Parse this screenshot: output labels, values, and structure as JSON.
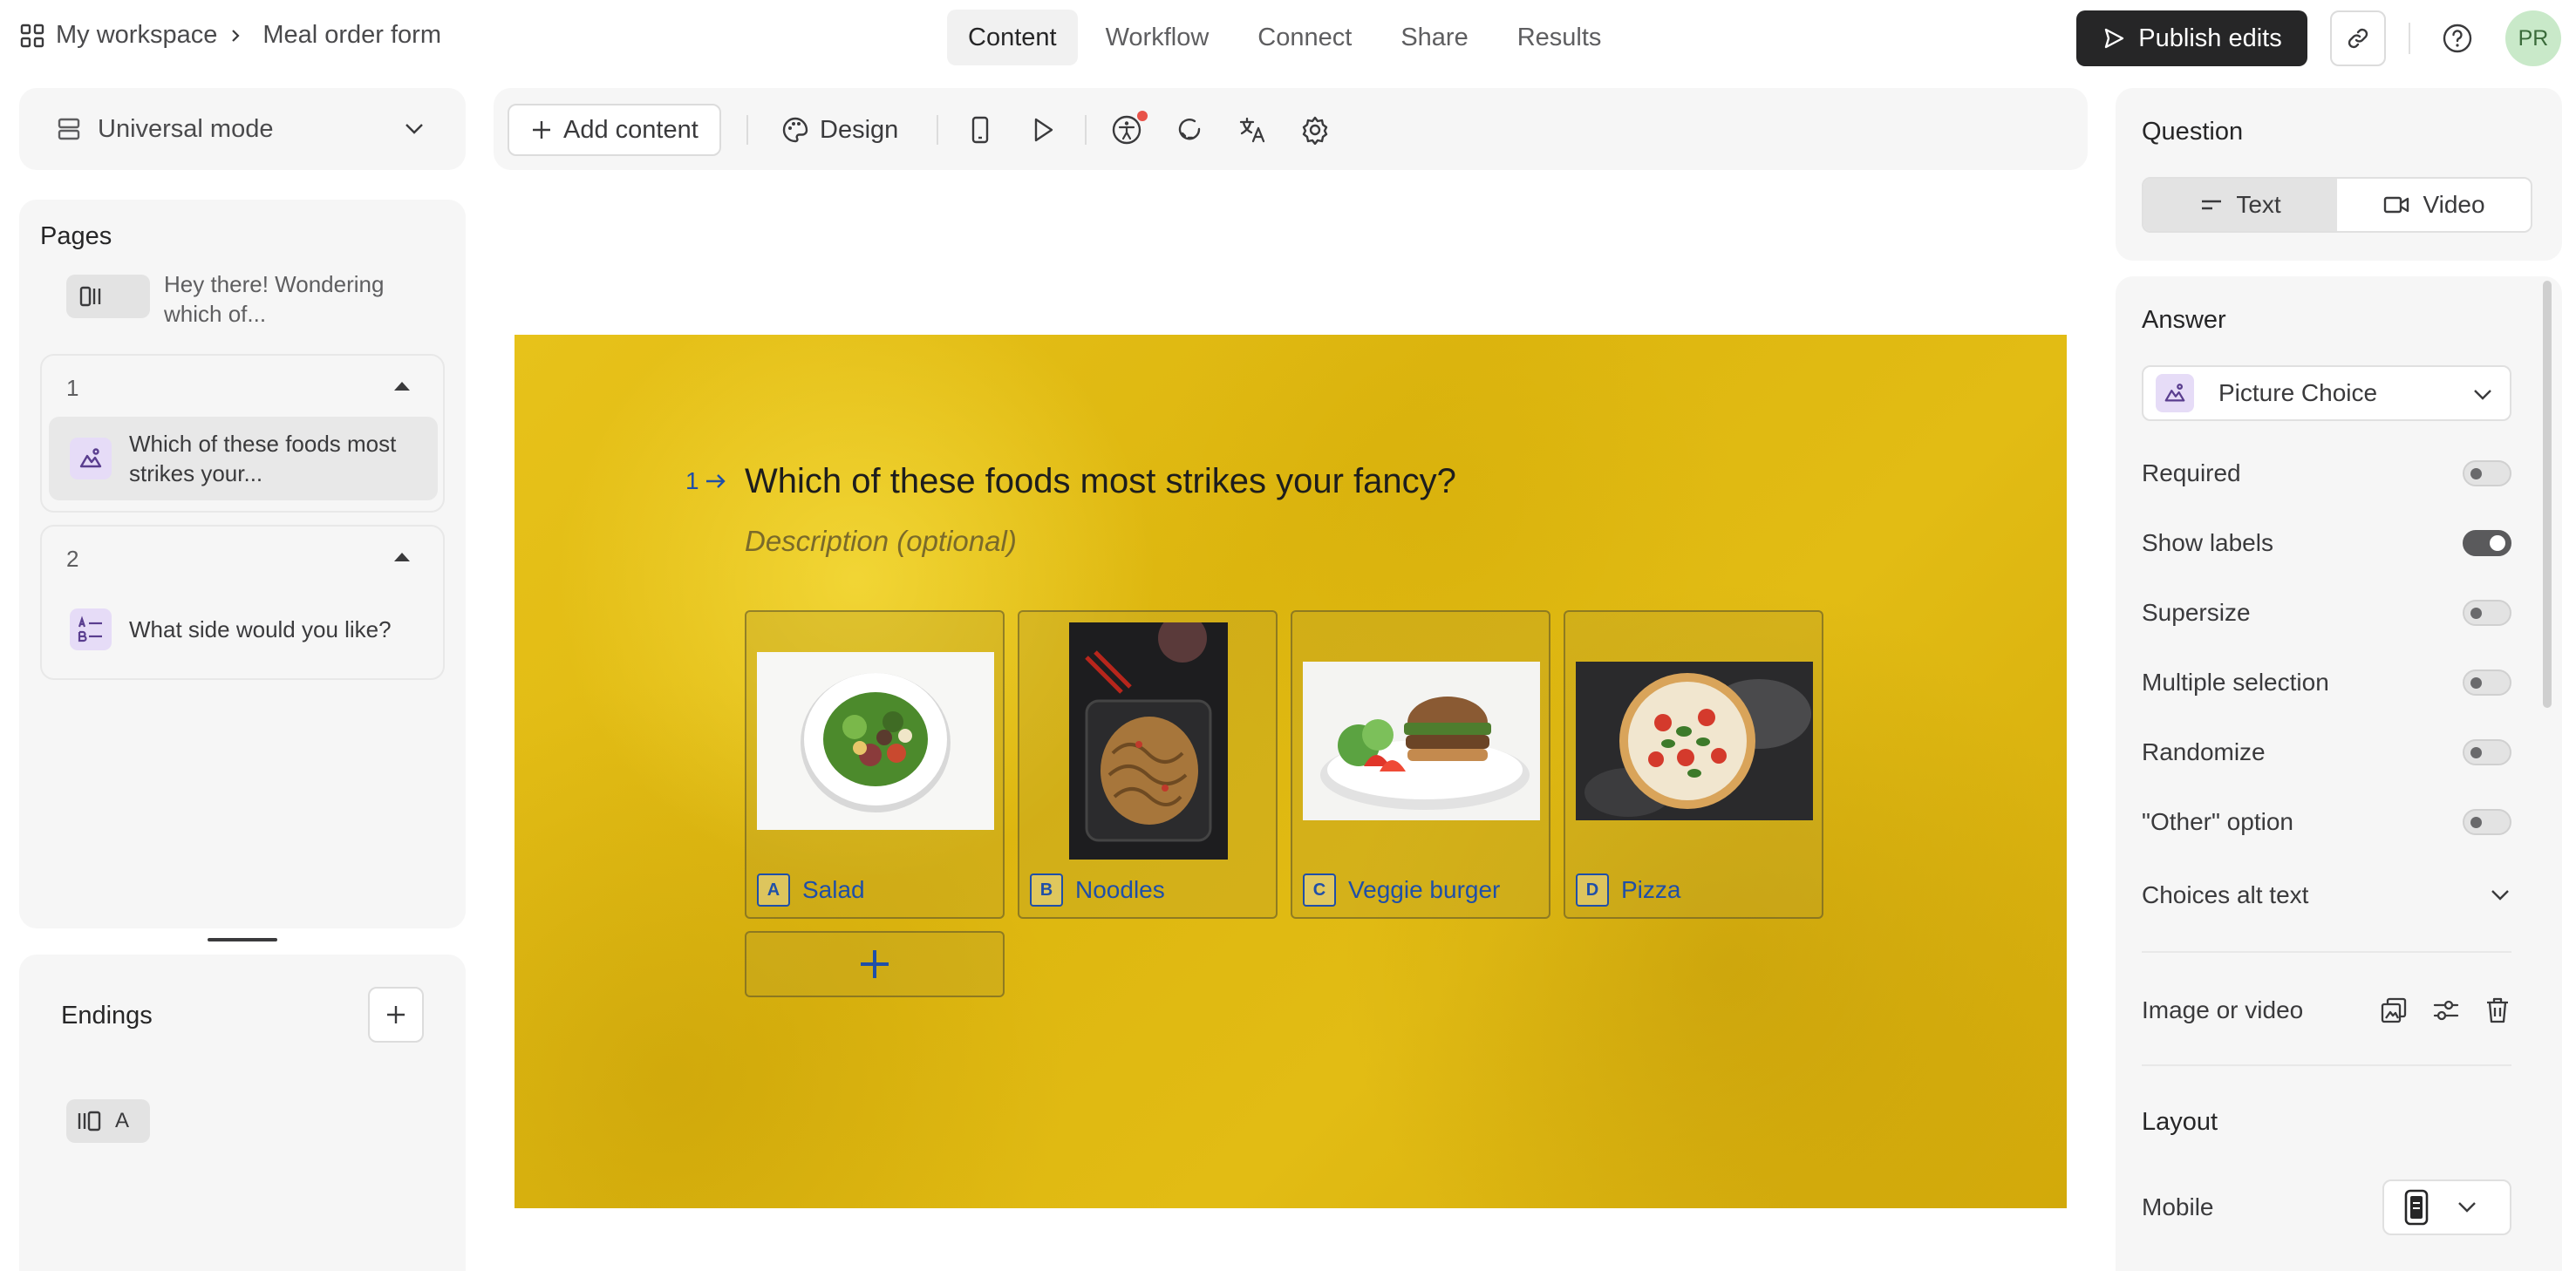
{
  "breadcrumb": {
    "workspace": "My workspace",
    "form": "Meal order form"
  },
  "nav": {
    "tabs": [
      "Content",
      "Workflow",
      "Connect",
      "Share",
      "Results"
    ],
    "active": "Content"
  },
  "header": {
    "publish_label": "Publish edits",
    "avatar_initials": "PR"
  },
  "left": {
    "mode_label": "Universal mode",
    "pages_title": "Pages",
    "welcome_text": "Hey there! Wondering which of...",
    "pages": [
      {
        "number": "1",
        "question": "Which of these foods most strikes your..."
      },
      {
        "number": "2",
        "question": "What side would you like?"
      }
    ],
    "endings_title": "Endings",
    "ending_label": "A"
  },
  "toolbar": {
    "add_content": "Add content",
    "design": "Design"
  },
  "canvas": {
    "question_number": "1",
    "question_title": "Which of these foods most strikes your fancy?",
    "description_placeholder": "Description (optional)",
    "choices": [
      {
        "key": "A",
        "label": "Salad"
      },
      {
        "key": "B",
        "label": "Noodles"
      },
      {
        "key": "C",
        "label": "Veggie burger"
      },
      {
        "key": "D",
        "label": "Pizza"
      }
    ],
    "theme": {
      "background": "#e0b915",
      "accent": "#1f4fa8"
    }
  },
  "right": {
    "question_title": "Question",
    "question_types": [
      "Text",
      "Video"
    ],
    "answer_title": "Answer",
    "answer_type": "Picture Choice",
    "settings": [
      {
        "label": "Required",
        "on": false
      },
      {
        "label": "Show labels",
        "on": true
      },
      {
        "label": "Supersize",
        "on": false
      },
      {
        "label": "Multiple selection",
        "on": false
      },
      {
        "label": "Randomize",
        "on": false
      },
      {
        "label": "\"Other\" option",
        "on": false
      }
    ],
    "alt_text_label": "Choices alt text",
    "image_video_label": "Image or video",
    "layout_title": "Layout",
    "mobile_label": "Mobile"
  }
}
